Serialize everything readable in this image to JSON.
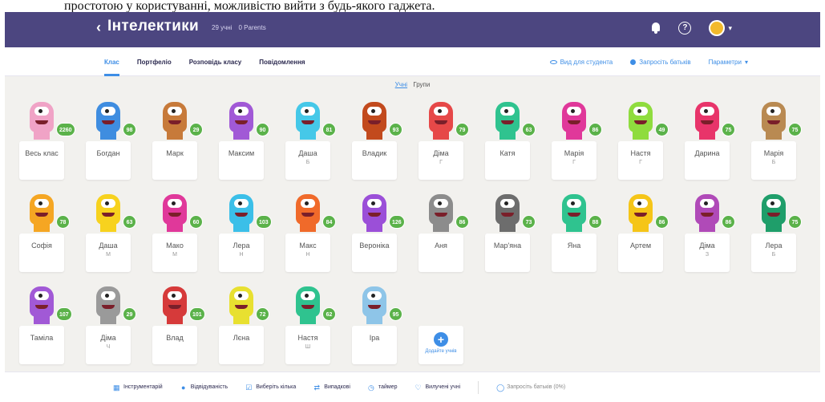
{
  "caption": "простотою у користуванні, можливістю вийти з будь-якого гаджета.",
  "header": {
    "back": "‹",
    "class_name": "Інтелектики",
    "students_count": "29 учні",
    "parents_count": "0 Parents",
    "bell_icon": "bell-icon",
    "help_icon": "help-icon"
  },
  "subnav": {
    "tabs": [
      "Клас",
      "Портфеліо",
      "Розповідь класу",
      "Повідомлення"
    ],
    "active_tab": 0,
    "right": [
      "Вид для студента",
      "Запросіть батьків",
      "Параметри"
    ]
  },
  "view_toggle": {
    "active": "Учні",
    "other": "Групи"
  },
  "accent": "#3e8ee6",
  "topbar_color": "#4c4680",
  "rows": [
    [
      {
        "name": "Весь клас",
        "score": "2260",
        "color": "#f0a3c6"
      },
      {
        "name": "Богдан",
        "score": "98",
        "color": "#3f8de0"
      },
      {
        "name": "Марк",
        "score": "29",
        "color": "#c77a3a"
      },
      {
        "name": "Максим",
        "score": "90",
        "color": "#a159d6"
      },
      {
        "name": "Даша",
        "sub": "Б",
        "score": "81",
        "color": "#45c8e8"
      },
      {
        "name": "Владик",
        "score": "93",
        "color": "#c24a1d"
      },
      {
        "name": "Діма",
        "sub": "Г",
        "score": "79",
        "color": "#e64848"
      },
      {
        "name": "Катя",
        "score": "63",
        "color": "#2fc38f"
      },
      {
        "name": "Марія",
        "sub": "Г",
        "score": "86",
        "color": "#e0389a"
      },
      {
        "name": "Настя",
        "sub": "Г",
        "score": "49",
        "color": "#8fdc3e"
      },
      {
        "name": "Дарина",
        "score": "75",
        "color": "#e8346a"
      },
      {
        "name": "Марія",
        "sub": "Б",
        "score": "75",
        "color": "#b98a52"
      }
    ],
    [
      {
        "name": "Софія",
        "score": "78",
        "color": "#f5a623"
      },
      {
        "name": "Даша",
        "sub": "М",
        "score": "63",
        "color": "#f7d21e"
      },
      {
        "name": "Мако",
        "sub": "М",
        "score": "60",
        "color": "#e0389a"
      },
      {
        "name": "Лера",
        "sub": "Н",
        "score": "103",
        "color": "#3bbfe8"
      },
      {
        "name": "Макс",
        "sub": "Н",
        "score": "84",
        "color": "#f06a2a"
      },
      {
        "name": "Вероніка",
        "score": "126",
        "color": "#9b4fd8"
      },
      {
        "name": "Аня",
        "score": "86",
        "color": "#8c8c8c"
      },
      {
        "name": "Мар'яна",
        "score": "73",
        "color": "#6d6d6d"
      },
      {
        "name": "Яна",
        "score": "88",
        "color": "#2fc38f"
      },
      {
        "name": "Артем",
        "score": "86",
        "color": "#f5c518"
      },
      {
        "name": "Діма",
        "sub": "З",
        "score": "86",
        "color": "#b04ab8"
      },
      {
        "name": "Лера",
        "sub": "Б",
        "score": "75",
        "color": "#1f9e6a"
      }
    ],
    [
      {
        "name": "Таміла",
        "score": "107",
        "color": "#a159d6"
      },
      {
        "name": "Діма",
        "sub": "Ч",
        "score": "29",
        "color": "#9a9a9a"
      },
      {
        "name": "Влад",
        "score": "101",
        "color": "#d63a3a"
      },
      {
        "name": "Лєна",
        "score": "72",
        "color": "#e8e030"
      },
      {
        "name": "Настя",
        "sub": "Ш",
        "score": "62",
        "color": "#2fc38f"
      },
      {
        "name": "Іра",
        "score": "95",
        "color": "#8ec5e8"
      }
    ]
  ],
  "add_student": "Додайте учнів",
  "bottombar": [
    {
      "label": "Інструментарій",
      "icon": "grid-icon"
    },
    {
      "label": "Відвідуваність",
      "icon": "check-circle-icon"
    },
    {
      "label": "Виберіть кілька",
      "icon": "select-icon"
    },
    {
      "label": "Випадкові",
      "icon": "shuffle-icon"
    },
    {
      "label": "таймер",
      "icon": "timer-icon"
    },
    {
      "label": "Вилучені учні",
      "icon": "heart-icon"
    },
    {
      "label": "Запросіть батьків (0%)",
      "icon": "invite-icon",
      "muted": true
    }
  ]
}
